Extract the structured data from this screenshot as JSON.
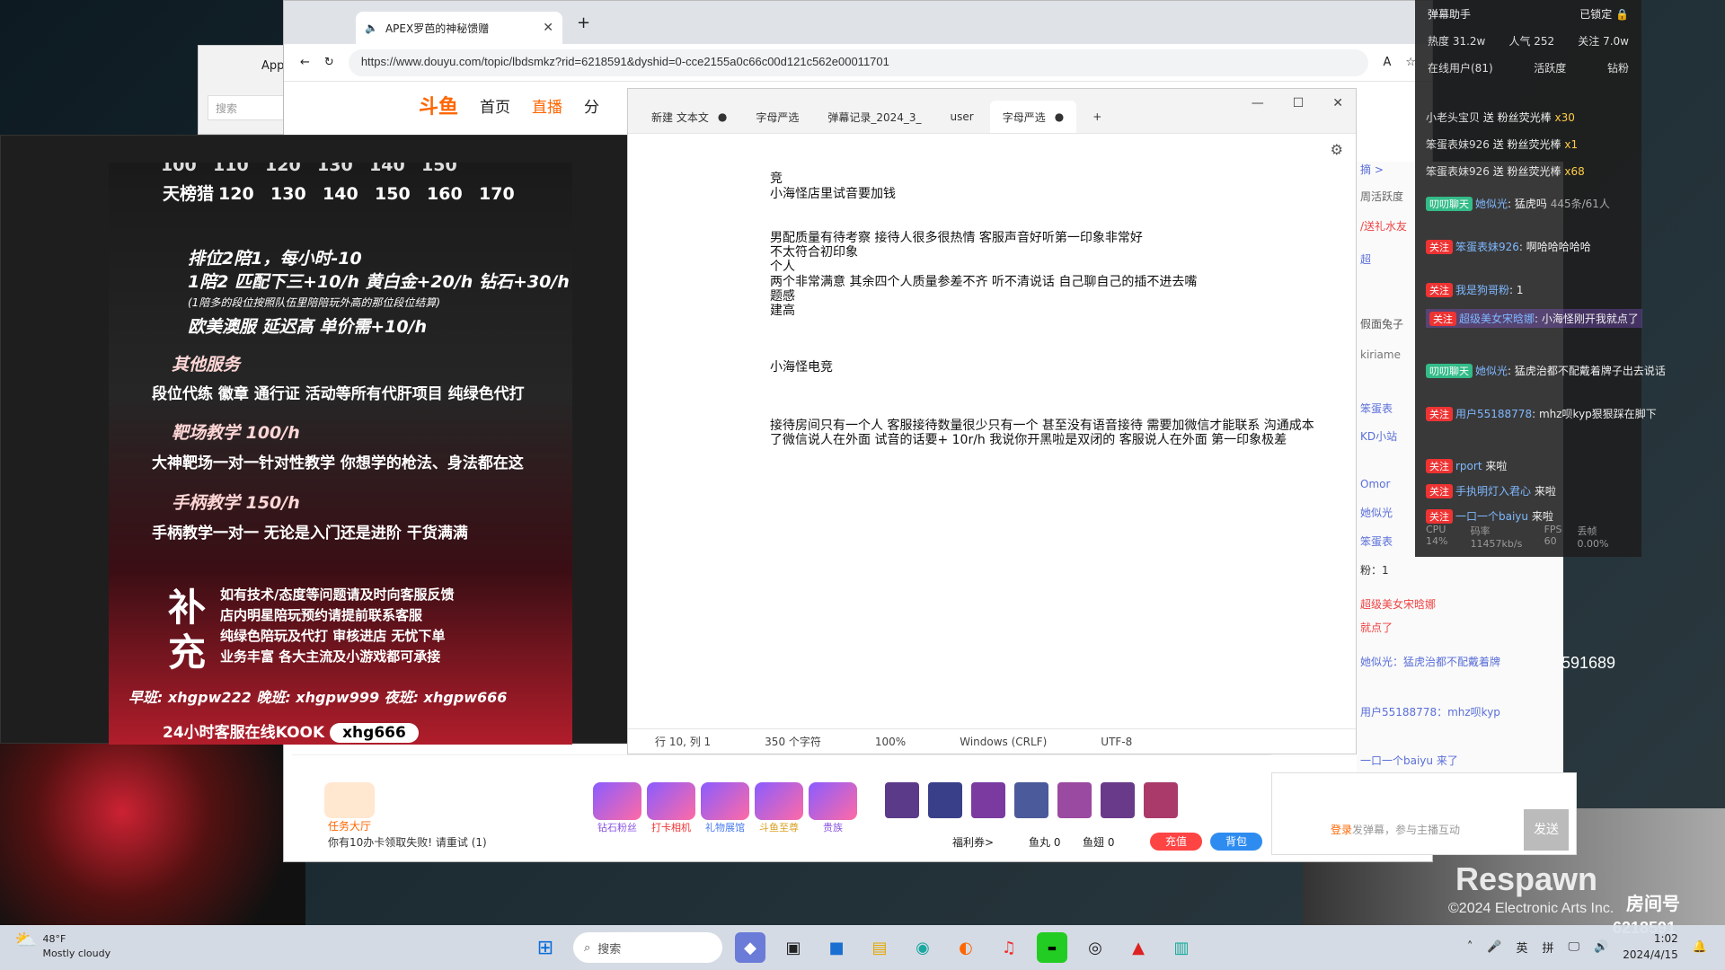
{
  "wallpaper": {
    "brand": "Respawn",
    "brand_sub": "©2024 Electronic Arts Inc.",
    "room_label": "房间号",
    "room_no": "6218591",
    "side_number": "591689"
  },
  "app_back": {
    "title": "App",
    "search": "搜索"
  },
  "browser": {
    "tab_title": "APEX罗芭的神秘馈赠",
    "url": "https://www.douyu.com/topic/lbdsmkz?rid=6218591&dyshid=0-cce2155a0c66c00d121c562e00011701",
    "site_logo": "斗鱼",
    "nav": [
      "首页",
      "直播",
      "分"
    ]
  },
  "poster": {
    "price_label": "天榜猎",
    "prices": [
      "120",
      "130",
      "140",
      "150",
      "160",
      "170"
    ],
    "top_prices": [
      "100",
      "110",
      "120",
      "130",
      "140",
      "150"
    ],
    "rank_lines": [
      "排位2陪1，每小时-10",
      "1陪2 匹配下三+10/h 黄白金+20/h 钻石+30/h",
      "(1陪多的段位按照队伍里陪陪玩外高的那位段位结算)",
      "欧美澳服 延迟高 单价需+10/h"
    ],
    "other_heading": "其他服务",
    "other_text": "段位代练 徽章 通行证 活动等所有代肝项目 纯绿色代打",
    "range_heading": "靶场教学 100/h",
    "range_text": "大神靶场一对一针对性教学 你想学的枪法、身法都在这",
    "pad_heading": "手柄教学 150/h",
    "pad_text": "手柄教学一对一 无论是入门还是进阶 干货满满",
    "supplement_chars": [
      "补",
      "充"
    ],
    "supplement_lines": [
      "如有技术/态度等问题请及时向客服反馈",
      "店内明星陪玩预约请提前联系客服",
      "纯绿色陪玩及代打 审核进店 无忧下单",
      "业务丰富 各大主流及小游戏都可承接"
    ],
    "shifts": "早班: xhgpw222    晚班: xhgpw999    夜班: xhgpw666",
    "kook_label": "24小时客服在线KOOK",
    "kook_id": "xhg666"
  },
  "notepad": {
    "tabs": [
      "新建 文本文",
      "字母严选",
      "弹幕记录_2024_3_",
      "user",
      "字母严选"
    ],
    "lines": [
      "竞",
      "小海怪店里试音要加钱",
      "",
      "",
      "男配质量有待考察  接待人很多很热情  客服声音好听第一印象非常好",
      "  不太符合初印象",
      "个人",
      "两个非常满意  其余四个人质量参差不齐  听不清说话  自己聊自己的插不进去嘴",
      "题感",
      "建高",
      "",
      "",
      "",
      "小海怪电竞",
      "",
      "",
      "",
      "接待房间只有一个人  客服接待数量很少只有一个  甚至没有语音接待 需要加微信才能联系 沟通成本",
      "了微信说人在外面 试音的话要+ 10r/h 我说你开黑啦是双闭的 客服说人在外面 第一印象极差"
    ],
    "status": [
      "行 10, 列 1",
      "350 个字符",
      "100%",
      "Windows (CRLF)",
      "UTF-8"
    ]
  },
  "page_right": {
    "lines": [
      "摘 >",
      "周活跃度",
      "/送礼水友",
      "超",
      "假面兔子",
      "kiriame",
      "笨蛋表",
      "KD小站",
      "Omor",
      "她似光",
      "笨蛋表",
      "粉：1",
      "超级美女宋晗娜",
      "就点了",
      "她似光：猛虎治都不配戴着牌",
      "用户55188778：mhz呗kyp",
      "一口一个baiyu 来了"
    ]
  },
  "gift_bar": {
    "task_label": "任务大厅",
    "gifts": [
      "钻石粉丝",
      "打卡相机",
      "礼物展馆",
      "斗鱼至尊",
      "贵族"
    ],
    "notice": "你有10办卡领取失败! 请重试 (1)",
    "welfare": "福利券>",
    "fish_ball": "鱼丸 0",
    "fish_wing": "鱼翅 0",
    "recharge": "充值",
    "backpack": "背包"
  },
  "chat_input": {
    "login": "登录",
    "placeholder": "发弹幕，参与主播互动",
    "send": "发送"
  },
  "danmaku": {
    "title": "弹幕助手",
    "locked": "已锁定",
    "heat": "热度 31.2w",
    "popularity": "人气 252",
    "follow": "关注 7.0w",
    "online": "在线用户(81)",
    "activity": "活跃度",
    "right_tab": "钻粉",
    "gifts": [
      {
        "user": "小老头宝贝",
        "action": "送 粉丝荧光棒",
        "count": "x30"
      },
      {
        "user": "笨蛋表妹926",
        "action": "送 粉丝荧光棒",
        "count": "x1"
      },
      {
        "user": "笨蛋表妹926",
        "action": "送 粉丝荧光棒",
        "count": "x68"
      }
    ],
    "messages": [
      {
        "badge": "叨叨聊天",
        "nick": "她似光",
        "text": "猛虎吗",
        "extra": "445条/61人"
      },
      {
        "badge": "关注",
        "nick": "笨蛋表妹926",
        "text": "啊哈哈哈哈哈"
      },
      {
        "badge": "关注",
        "nick": "我是狗哥粉",
        "text": "1"
      },
      {
        "badge": "关注",
        "nick": "超级美女宋晗娜",
        "text": "小海怪刚开我就点了"
      },
      {
        "badge": "叨叨聊天",
        "nick": "她似光",
        "text": "猛虎治都不配戴着牌子出去说话"
      },
      {
        "badge": "关注",
        "nick": "用户55188778",
        "text": "mhz呗kyp狠狠踩在脚下"
      },
      {
        "badge": "关注",
        "nick": "rport",
        "text": "来啦"
      },
      {
        "badge": "关注",
        "nick": "手执明灯入君心",
        "text": "来啦"
      },
      {
        "badge": "关注",
        "nick": "一口一个baiyu",
        "text": "来啦"
      }
    ],
    "cpu": "CPU 14%",
    "bitrate": "码率 11457kb/s",
    "fps": "FPS 60",
    "drop": "丢帧 0.00%"
  },
  "taskbar": {
    "temp": "48°F",
    "weather": "Mostly cloudy",
    "search": "搜索",
    "lang1": "英",
    "lang2": "拼",
    "time": "1:02",
    "date": "2024/4/15"
  }
}
